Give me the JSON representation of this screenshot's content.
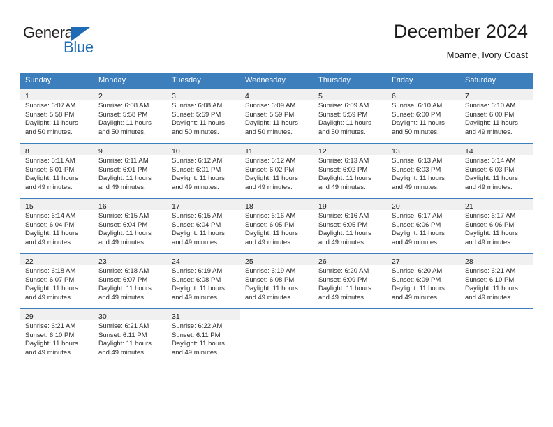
{
  "brand": {
    "name_part1": "General",
    "name_part2": "Blue",
    "triangle_color": "#1f6cb4"
  },
  "header": {
    "title": "December 2024",
    "subtitle": "Moame, Ivory Coast",
    "header_bg_color": "#3d7ebd"
  },
  "weekdays": [
    "Sunday",
    "Monday",
    "Tuesday",
    "Wednesday",
    "Thursday",
    "Friday",
    "Saturday"
  ],
  "weeks": [
    [
      {
        "day": "1",
        "sunrise": "Sunrise: 6:07 AM",
        "sunset": "Sunset: 5:58 PM",
        "daylight1": "Daylight: 11 hours",
        "daylight2": "and 50 minutes."
      },
      {
        "day": "2",
        "sunrise": "Sunrise: 6:08 AM",
        "sunset": "Sunset: 5:58 PM",
        "daylight1": "Daylight: 11 hours",
        "daylight2": "and 50 minutes."
      },
      {
        "day": "3",
        "sunrise": "Sunrise: 6:08 AM",
        "sunset": "Sunset: 5:59 PM",
        "daylight1": "Daylight: 11 hours",
        "daylight2": "and 50 minutes."
      },
      {
        "day": "4",
        "sunrise": "Sunrise: 6:09 AM",
        "sunset": "Sunset: 5:59 PM",
        "daylight1": "Daylight: 11 hours",
        "daylight2": "and 50 minutes."
      },
      {
        "day": "5",
        "sunrise": "Sunrise: 6:09 AM",
        "sunset": "Sunset: 5:59 PM",
        "daylight1": "Daylight: 11 hours",
        "daylight2": "and 50 minutes."
      },
      {
        "day": "6",
        "sunrise": "Sunrise: 6:10 AM",
        "sunset": "Sunset: 6:00 PM",
        "daylight1": "Daylight: 11 hours",
        "daylight2": "and 50 minutes."
      },
      {
        "day": "7",
        "sunrise": "Sunrise: 6:10 AM",
        "sunset": "Sunset: 6:00 PM",
        "daylight1": "Daylight: 11 hours",
        "daylight2": "and 49 minutes."
      }
    ],
    [
      {
        "day": "8",
        "sunrise": "Sunrise: 6:11 AM",
        "sunset": "Sunset: 6:01 PM",
        "daylight1": "Daylight: 11 hours",
        "daylight2": "and 49 minutes."
      },
      {
        "day": "9",
        "sunrise": "Sunrise: 6:11 AM",
        "sunset": "Sunset: 6:01 PM",
        "daylight1": "Daylight: 11 hours",
        "daylight2": "and 49 minutes."
      },
      {
        "day": "10",
        "sunrise": "Sunrise: 6:12 AM",
        "sunset": "Sunset: 6:01 PM",
        "daylight1": "Daylight: 11 hours",
        "daylight2": "and 49 minutes."
      },
      {
        "day": "11",
        "sunrise": "Sunrise: 6:12 AM",
        "sunset": "Sunset: 6:02 PM",
        "daylight1": "Daylight: 11 hours",
        "daylight2": "and 49 minutes."
      },
      {
        "day": "12",
        "sunrise": "Sunrise: 6:13 AM",
        "sunset": "Sunset: 6:02 PM",
        "daylight1": "Daylight: 11 hours",
        "daylight2": "and 49 minutes."
      },
      {
        "day": "13",
        "sunrise": "Sunrise: 6:13 AM",
        "sunset": "Sunset: 6:03 PM",
        "daylight1": "Daylight: 11 hours",
        "daylight2": "and 49 minutes."
      },
      {
        "day": "14",
        "sunrise": "Sunrise: 6:14 AM",
        "sunset": "Sunset: 6:03 PM",
        "daylight1": "Daylight: 11 hours",
        "daylight2": "and 49 minutes."
      }
    ],
    [
      {
        "day": "15",
        "sunrise": "Sunrise: 6:14 AM",
        "sunset": "Sunset: 6:04 PM",
        "daylight1": "Daylight: 11 hours",
        "daylight2": "and 49 minutes."
      },
      {
        "day": "16",
        "sunrise": "Sunrise: 6:15 AM",
        "sunset": "Sunset: 6:04 PM",
        "daylight1": "Daylight: 11 hours",
        "daylight2": "and 49 minutes."
      },
      {
        "day": "17",
        "sunrise": "Sunrise: 6:15 AM",
        "sunset": "Sunset: 6:04 PM",
        "daylight1": "Daylight: 11 hours",
        "daylight2": "and 49 minutes."
      },
      {
        "day": "18",
        "sunrise": "Sunrise: 6:16 AM",
        "sunset": "Sunset: 6:05 PM",
        "daylight1": "Daylight: 11 hours",
        "daylight2": "and 49 minutes."
      },
      {
        "day": "19",
        "sunrise": "Sunrise: 6:16 AM",
        "sunset": "Sunset: 6:05 PM",
        "daylight1": "Daylight: 11 hours",
        "daylight2": "and 49 minutes."
      },
      {
        "day": "20",
        "sunrise": "Sunrise: 6:17 AM",
        "sunset": "Sunset: 6:06 PM",
        "daylight1": "Daylight: 11 hours",
        "daylight2": "and 49 minutes."
      },
      {
        "day": "21",
        "sunrise": "Sunrise: 6:17 AM",
        "sunset": "Sunset: 6:06 PM",
        "daylight1": "Daylight: 11 hours",
        "daylight2": "and 49 minutes."
      }
    ],
    [
      {
        "day": "22",
        "sunrise": "Sunrise: 6:18 AM",
        "sunset": "Sunset: 6:07 PM",
        "daylight1": "Daylight: 11 hours",
        "daylight2": "and 49 minutes."
      },
      {
        "day": "23",
        "sunrise": "Sunrise: 6:18 AM",
        "sunset": "Sunset: 6:07 PM",
        "daylight1": "Daylight: 11 hours",
        "daylight2": "and 49 minutes."
      },
      {
        "day": "24",
        "sunrise": "Sunrise: 6:19 AM",
        "sunset": "Sunset: 6:08 PM",
        "daylight1": "Daylight: 11 hours",
        "daylight2": "and 49 minutes."
      },
      {
        "day": "25",
        "sunrise": "Sunrise: 6:19 AM",
        "sunset": "Sunset: 6:08 PM",
        "daylight1": "Daylight: 11 hours",
        "daylight2": "and 49 minutes."
      },
      {
        "day": "26",
        "sunrise": "Sunrise: 6:20 AM",
        "sunset": "Sunset: 6:09 PM",
        "daylight1": "Daylight: 11 hours",
        "daylight2": "and 49 minutes."
      },
      {
        "day": "27",
        "sunrise": "Sunrise: 6:20 AM",
        "sunset": "Sunset: 6:09 PM",
        "daylight1": "Daylight: 11 hours",
        "daylight2": "and 49 minutes."
      },
      {
        "day": "28",
        "sunrise": "Sunrise: 6:21 AM",
        "sunset": "Sunset: 6:10 PM",
        "daylight1": "Daylight: 11 hours",
        "daylight2": "and 49 minutes."
      }
    ],
    [
      {
        "day": "29",
        "sunrise": "Sunrise: 6:21 AM",
        "sunset": "Sunset: 6:10 PM",
        "daylight1": "Daylight: 11 hours",
        "daylight2": "and 49 minutes."
      },
      {
        "day": "30",
        "sunrise": "Sunrise: 6:21 AM",
        "sunset": "Sunset: 6:11 PM",
        "daylight1": "Daylight: 11 hours",
        "daylight2": "and 49 minutes."
      },
      {
        "day": "31",
        "sunrise": "Sunrise: 6:22 AM",
        "sunset": "Sunset: 6:11 PM",
        "daylight1": "Daylight: 11 hours",
        "daylight2": "and 49 minutes."
      },
      {
        "day": "",
        "sunrise": "",
        "sunset": "",
        "daylight1": "",
        "daylight2": ""
      },
      {
        "day": "",
        "sunrise": "",
        "sunset": "",
        "daylight1": "",
        "daylight2": ""
      },
      {
        "day": "",
        "sunrise": "",
        "sunset": "",
        "daylight1": "",
        "daylight2": ""
      },
      {
        "day": "",
        "sunrise": "",
        "sunset": "",
        "daylight1": "",
        "daylight2": ""
      }
    ]
  ]
}
